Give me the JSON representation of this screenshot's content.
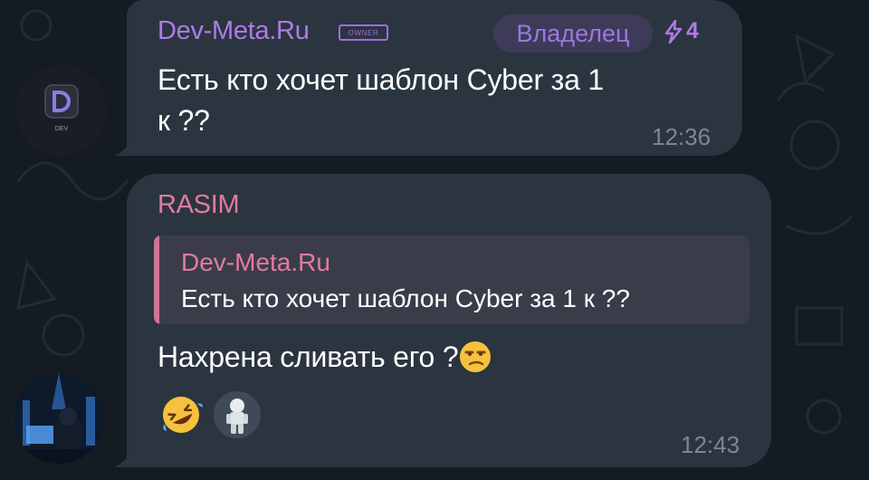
{
  "message1": {
    "sender": "Dev-Meta.Ru",
    "sender_tag": "OWNER",
    "role_badge": "Владелец",
    "boost_count": "4",
    "text_line1": "Есть кто хочет шаблон Cyber за 1",
    "text_line2": "к ??",
    "time": "12:36",
    "avatar_label": "DEV"
  },
  "message2": {
    "sender": "RASIM",
    "reply": {
      "author": "Dev-Meta.Ru",
      "text": "Есть кто хочет шаблон Cyber за 1 к ??"
    },
    "text": "Нахрена сливать его ?",
    "time": "12:43",
    "reactions": [
      "rolling-on-floor-laughing-emoji",
      "astronaut-sticker"
    ]
  },
  "colors": {
    "background": "#151b22",
    "bubble": "#2b3540",
    "sender1": "#b07ae6",
    "sender2": "#e17c9e",
    "role_badge_bg": "#3e3b58",
    "timestamp": "#7c8794"
  }
}
